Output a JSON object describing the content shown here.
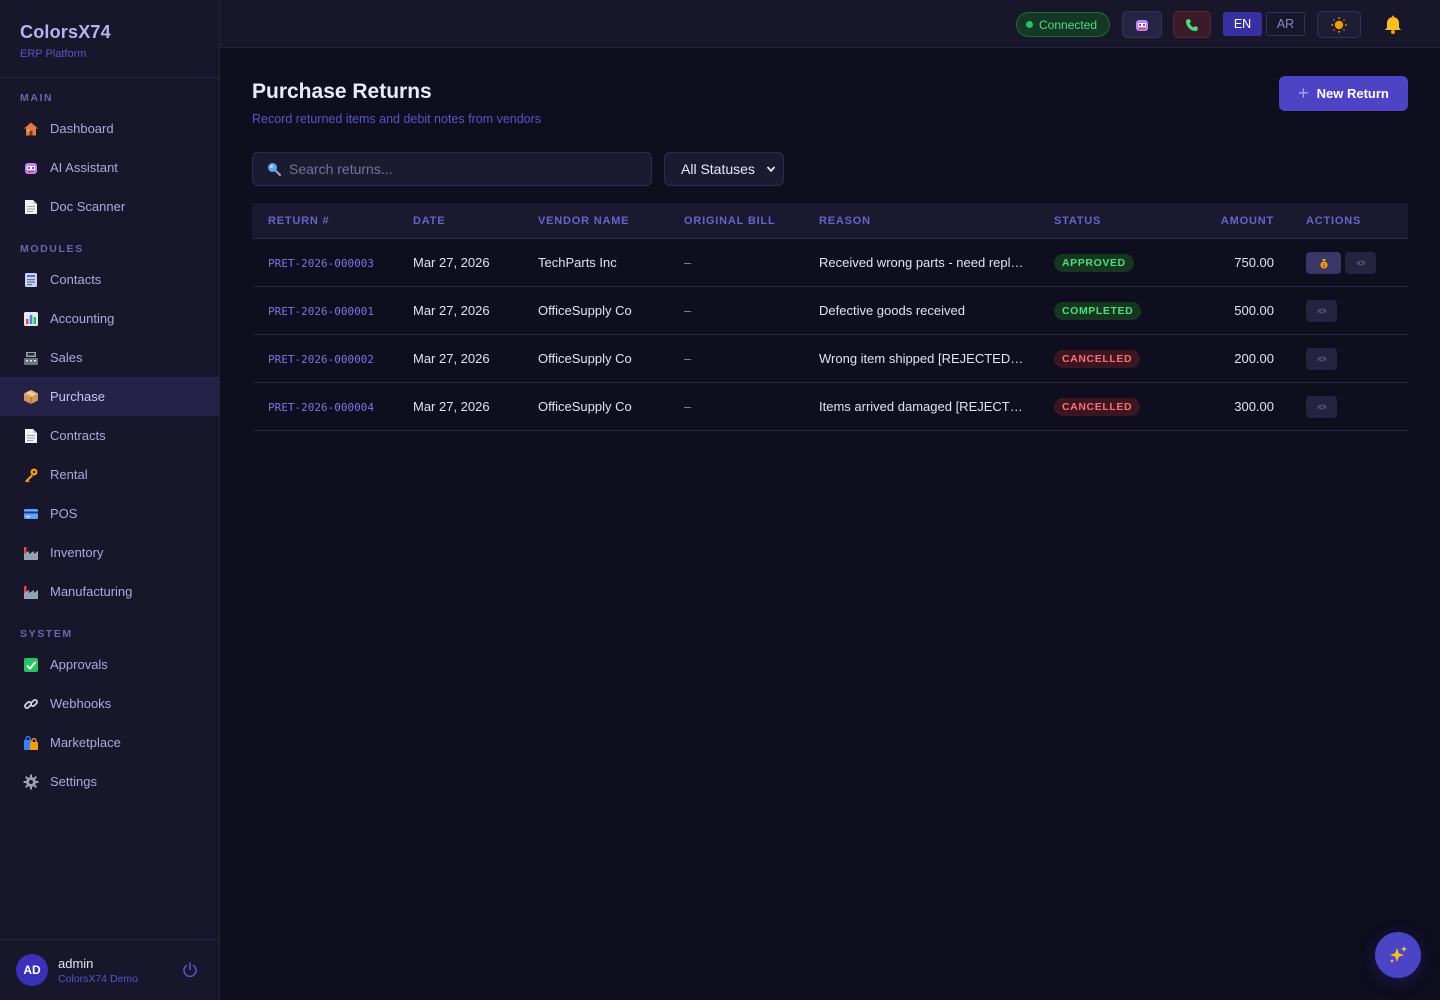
{
  "brand": {
    "title": "ColorsX74",
    "subtitle": "ERP Platform"
  },
  "sidebar": {
    "sections": [
      {
        "label": "MAIN"
      },
      {
        "label": "MODULES"
      },
      {
        "label": "SYSTEM"
      }
    ],
    "items": [
      {
        "label": "Dashboard",
        "icon": "house-icon"
      },
      {
        "label": "AI Assistant",
        "icon": "robot-icon"
      },
      {
        "label": "Doc Scanner",
        "icon": "document-icon"
      },
      {
        "label": "Contacts",
        "icon": "contacts-card-icon"
      },
      {
        "label": "Accounting",
        "icon": "bar-chart-icon"
      },
      {
        "label": "Sales",
        "icon": "cash-register-icon"
      },
      {
        "label": "Purchase",
        "icon": "package-icon",
        "active": true
      },
      {
        "label": "Contracts",
        "icon": "document-icon"
      },
      {
        "label": "Rental",
        "icon": "key-icon"
      },
      {
        "label": "POS",
        "icon": "credit-card-icon"
      },
      {
        "label": "Inventory",
        "icon": "factory-icon"
      },
      {
        "label": "Manufacturing",
        "icon": "factory-icon"
      },
      {
        "label": "Approvals",
        "icon": "check-box-icon"
      },
      {
        "label": "Webhooks",
        "icon": "link-icon"
      },
      {
        "label": "Marketplace",
        "icon": "shopping-bags-icon"
      },
      {
        "label": "Settings",
        "icon": "gear-icon"
      }
    ]
  },
  "user": {
    "initials": "AD",
    "name": "admin",
    "org": "ColorsX74 Demo"
  },
  "topbar": {
    "connection": "Connected",
    "lang_en": "EN",
    "lang_ar": "AR"
  },
  "page": {
    "title": "Purchase Returns",
    "subtitle": "Record returned items and debit notes from vendors",
    "new_button": "New Return",
    "search_placeholder": "Search returns...",
    "status_filter": "All Statuses"
  },
  "table": {
    "columns": [
      "RETURN #",
      "DATE",
      "VENDOR NAME",
      "ORIGINAL BILL",
      "REASON",
      "STATUS",
      "AMOUNT",
      "ACTIONS"
    ],
    "rows": [
      {
        "return_no": "PRET-2026-000003",
        "date": "Mar 27, 2026",
        "vendor": "TechParts Inc",
        "bill": "–",
        "reason": "Received wrong parts - need replacement",
        "status": "APPROVED",
        "amount": "750.00",
        "actions": [
          "refund-icon",
          "view-icon"
        ]
      },
      {
        "return_no": "PRET-2026-000001",
        "date": "Mar 27, 2026",
        "vendor": "OfficeSupply Co",
        "bill": "–",
        "reason": "Defective goods received",
        "status": "COMPLETED",
        "amount": "500.00",
        "actions": [
          "view-icon"
        ]
      },
      {
        "return_no": "PRET-2026-000002",
        "date": "Mar 27, 2026",
        "vendor": "OfficeSupply Co",
        "bill": "–",
        "reason": "Wrong item shipped [REJECTED] ...",
        "status": "CANCELLED",
        "amount": "200.00",
        "actions": [
          "view-icon"
        ]
      },
      {
        "return_no": "PRET-2026-000004",
        "date": "Mar 27, 2026",
        "vendor": "OfficeSupply Co",
        "bill": "–",
        "reason": "Items arrived damaged [REJECTED]",
        "status": "CANCELLED",
        "amount": "300.00",
        "actions": [
          "view-icon"
        ]
      }
    ]
  },
  "colors": {
    "accent": "#4c43c5",
    "success": "#4ade80",
    "danger": "#f87171",
    "background": "#0f0e1f",
    "sidebar": "#17162b"
  }
}
